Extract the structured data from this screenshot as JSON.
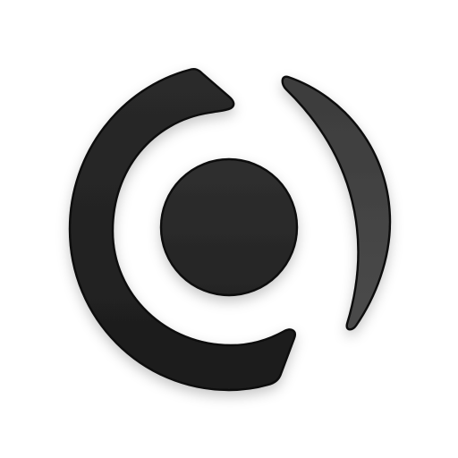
{
  "logo": {
    "name": "app-logo",
    "colors": {
      "background": "#ffffff",
      "ring_top": "#2a2a2a",
      "ring_bottom": "#1c1c1c",
      "crescent_top": "#3c3c3c",
      "crescent_bottom": "#4a4a4a",
      "dot_top": "#2f2f2f",
      "dot_bottom": "#242424",
      "outline": "#0a0a0a"
    }
  }
}
